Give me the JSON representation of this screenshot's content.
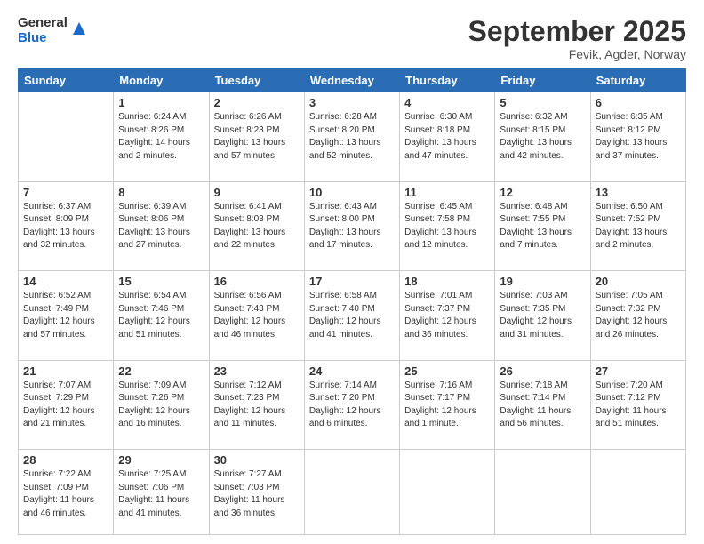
{
  "logo": {
    "general": "General",
    "blue": "Blue"
  },
  "header": {
    "month": "September 2025",
    "location": "Fevik, Agder, Norway"
  },
  "days_of_week": [
    "Sunday",
    "Monday",
    "Tuesday",
    "Wednesday",
    "Thursday",
    "Friday",
    "Saturday"
  ],
  "weeks": [
    [
      {
        "day": "",
        "info": ""
      },
      {
        "day": "1",
        "info": "Sunrise: 6:24 AM\nSunset: 8:26 PM\nDaylight: 14 hours\nand 2 minutes."
      },
      {
        "day": "2",
        "info": "Sunrise: 6:26 AM\nSunset: 8:23 PM\nDaylight: 13 hours\nand 57 minutes."
      },
      {
        "day": "3",
        "info": "Sunrise: 6:28 AM\nSunset: 8:20 PM\nDaylight: 13 hours\nand 52 minutes."
      },
      {
        "day": "4",
        "info": "Sunrise: 6:30 AM\nSunset: 8:18 PM\nDaylight: 13 hours\nand 47 minutes."
      },
      {
        "day": "5",
        "info": "Sunrise: 6:32 AM\nSunset: 8:15 PM\nDaylight: 13 hours\nand 42 minutes."
      },
      {
        "day": "6",
        "info": "Sunrise: 6:35 AM\nSunset: 8:12 PM\nDaylight: 13 hours\nand 37 minutes."
      }
    ],
    [
      {
        "day": "7",
        "info": "Sunrise: 6:37 AM\nSunset: 8:09 PM\nDaylight: 13 hours\nand 32 minutes."
      },
      {
        "day": "8",
        "info": "Sunrise: 6:39 AM\nSunset: 8:06 PM\nDaylight: 13 hours\nand 27 minutes."
      },
      {
        "day": "9",
        "info": "Sunrise: 6:41 AM\nSunset: 8:03 PM\nDaylight: 13 hours\nand 22 minutes."
      },
      {
        "day": "10",
        "info": "Sunrise: 6:43 AM\nSunset: 8:00 PM\nDaylight: 13 hours\nand 17 minutes."
      },
      {
        "day": "11",
        "info": "Sunrise: 6:45 AM\nSunset: 7:58 PM\nDaylight: 13 hours\nand 12 minutes."
      },
      {
        "day": "12",
        "info": "Sunrise: 6:48 AM\nSunset: 7:55 PM\nDaylight: 13 hours\nand 7 minutes."
      },
      {
        "day": "13",
        "info": "Sunrise: 6:50 AM\nSunset: 7:52 PM\nDaylight: 13 hours\nand 2 minutes."
      }
    ],
    [
      {
        "day": "14",
        "info": "Sunrise: 6:52 AM\nSunset: 7:49 PM\nDaylight: 12 hours\nand 57 minutes."
      },
      {
        "day": "15",
        "info": "Sunrise: 6:54 AM\nSunset: 7:46 PM\nDaylight: 12 hours\nand 51 minutes."
      },
      {
        "day": "16",
        "info": "Sunrise: 6:56 AM\nSunset: 7:43 PM\nDaylight: 12 hours\nand 46 minutes."
      },
      {
        "day": "17",
        "info": "Sunrise: 6:58 AM\nSunset: 7:40 PM\nDaylight: 12 hours\nand 41 minutes."
      },
      {
        "day": "18",
        "info": "Sunrise: 7:01 AM\nSunset: 7:37 PM\nDaylight: 12 hours\nand 36 minutes."
      },
      {
        "day": "19",
        "info": "Sunrise: 7:03 AM\nSunset: 7:35 PM\nDaylight: 12 hours\nand 31 minutes."
      },
      {
        "day": "20",
        "info": "Sunrise: 7:05 AM\nSunset: 7:32 PM\nDaylight: 12 hours\nand 26 minutes."
      }
    ],
    [
      {
        "day": "21",
        "info": "Sunrise: 7:07 AM\nSunset: 7:29 PM\nDaylight: 12 hours\nand 21 minutes."
      },
      {
        "day": "22",
        "info": "Sunrise: 7:09 AM\nSunset: 7:26 PM\nDaylight: 12 hours\nand 16 minutes."
      },
      {
        "day": "23",
        "info": "Sunrise: 7:12 AM\nSunset: 7:23 PM\nDaylight: 12 hours\nand 11 minutes."
      },
      {
        "day": "24",
        "info": "Sunrise: 7:14 AM\nSunset: 7:20 PM\nDaylight: 12 hours\nand 6 minutes."
      },
      {
        "day": "25",
        "info": "Sunrise: 7:16 AM\nSunset: 7:17 PM\nDaylight: 12 hours\nand 1 minute."
      },
      {
        "day": "26",
        "info": "Sunrise: 7:18 AM\nSunset: 7:14 PM\nDaylight: 11 hours\nand 56 minutes."
      },
      {
        "day": "27",
        "info": "Sunrise: 7:20 AM\nSunset: 7:12 PM\nDaylight: 11 hours\nand 51 minutes."
      }
    ],
    [
      {
        "day": "28",
        "info": "Sunrise: 7:22 AM\nSunset: 7:09 PM\nDaylight: 11 hours\nand 46 minutes."
      },
      {
        "day": "29",
        "info": "Sunrise: 7:25 AM\nSunset: 7:06 PM\nDaylight: 11 hours\nand 41 minutes."
      },
      {
        "day": "30",
        "info": "Sunrise: 7:27 AM\nSunset: 7:03 PM\nDaylight: 11 hours\nand 36 minutes."
      },
      {
        "day": "",
        "info": ""
      },
      {
        "day": "",
        "info": ""
      },
      {
        "day": "",
        "info": ""
      },
      {
        "day": "",
        "info": ""
      }
    ]
  ]
}
